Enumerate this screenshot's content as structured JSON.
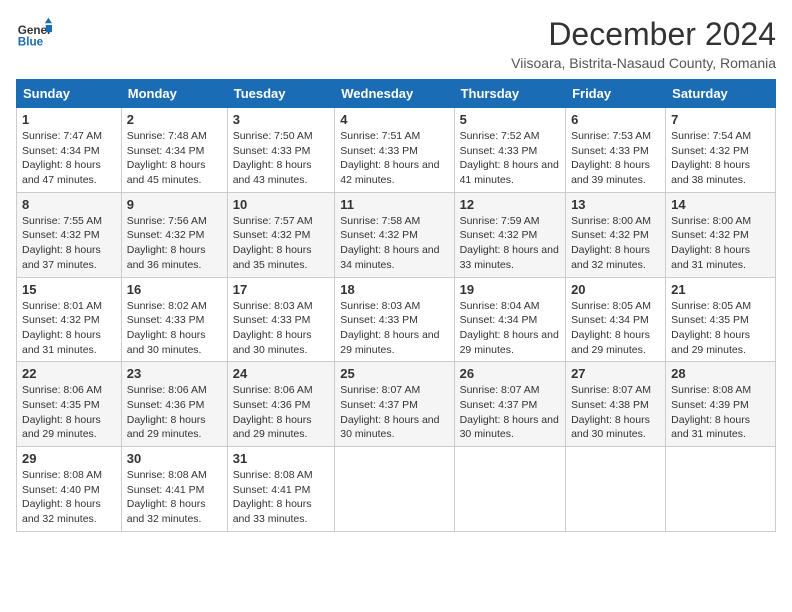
{
  "logo": {
    "general": "General",
    "blue": "Blue"
  },
  "title": "December 2024",
  "location": "Viisoara, Bistrita-Nasaud County, Romania",
  "headers": [
    "Sunday",
    "Monday",
    "Tuesday",
    "Wednesday",
    "Thursday",
    "Friday",
    "Saturday"
  ],
  "weeks": [
    [
      {
        "day": "1",
        "sunrise": "7:47 AM",
        "sunset": "4:34 PM",
        "daylight": "8 hours and 47 minutes."
      },
      {
        "day": "2",
        "sunrise": "7:48 AM",
        "sunset": "4:34 PM",
        "daylight": "8 hours and 45 minutes."
      },
      {
        "day": "3",
        "sunrise": "7:50 AM",
        "sunset": "4:33 PM",
        "daylight": "8 hours and 43 minutes."
      },
      {
        "day": "4",
        "sunrise": "7:51 AM",
        "sunset": "4:33 PM",
        "daylight": "8 hours and 42 minutes."
      },
      {
        "day": "5",
        "sunrise": "7:52 AM",
        "sunset": "4:33 PM",
        "daylight": "8 hours and 41 minutes."
      },
      {
        "day": "6",
        "sunrise": "7:53 AM",
        "sunset": "4:33 PM",
        "daylight": "8 hours and 39 minutes."
      },
      {
        "day": "7",
        "sunrise": "7:54 AM",
        "sunset": "4:32 PM",
        "daylight": "8 hours and 38 minutes."
      }
    ],
    [
      {
        "day": "8",
        "sunrise": "7:55 AM",
        "sunset": "4:32 PM",
        "daylight": "8 hours and 37 minutes."
      },
      {
        "day": "9",
        "sunrise": "7:56 AM",
        "sunset": "4:32 PM",
        "daylight": "8 hours and 36 minutes."
      },
      {
        "day": "10",
        "sunrise": "7:57 AM",
        "sunset": "4:32 PM",
        "daylight": "8 hours and 35 minutes."
      },
      {
        "day": "11",
        "sunrise": "7:58 AM",
        "sunset": "4:32 PM",
        "daylight": "8 hours and 34 minutes."
      },
      {
        "day": "12",
        "sunrise": "7:59 AM",
        "sunset": "4:32 PM",
        "daylight": "8 hours and 33 minutes."
      },
      {
        "day": "13",
        "sunrise": "8:00 AM",
        "sunset": "4:32 PM",
        "daylight": "8 hours and 32 minutes."
      },
      {
        "day": "14",
        "sunrise": "8:00 AM",
        "sunset": "4:32 PM",
        "daylight": "8 hours and 31 minutes."
      }
    ],
    [
      {
        "day": "15",
        "sunrise": "8:01 AM",
        "sunset": "4:32 PM",
        "daylight": "8 hours and 31 minutes."
      },
      {
        "day": "16",
        "sunrise": "8:02 AM",
        "sunset": "4:33 PM",
        "daylight": "8 hours and 30 minutes."
      },
      {
        "day": "17",
        "sunrise": "8:03 AM",
        "sunset": "4:33 PM",
        "daylight": "8 hours and 30 minutes."
      },
      {
        "day": "18",
        "sunrise": "8:03 AM",
        "sunset": "4:33 PM",
        "daylight": "8 hours and 29 minutes."
      },
      {
        "day": "19",
        "sunrise": "8:04 AM",
        "sunset": "4:34 PM",
        "daylight": "8 hours and 29 minutes."
      },
      {
        "day": "20",
        "sunrise": "8:05 AM",
        "sunset": "4:34 PM",
        "daylight": "8 hours and 29 minutes."
      },
      {
        "day": "21",
        "sunrise": "8:05 AM",
        "sunset": "4:35 PM",
        "daylight": "8 hours and 29 minutes."
      }
    ],
    [
      {
        "day": "22",
        "sunrise": "8:06 AM",
        "sunset": "4:35 PM",
        "daylight": "8 hours and 29 minutes."
      },
      {
        "day": "23",
        "sunrise": "8:06 AM",
        "sunset": "4:36 PM",
        "daylight": "8 hours and 29 minutes."
      },
      {
        "day": "24",
        "sunrise": "8:06 AM",
        "sunset": "4:36 PM",
        "daylight": "8 hours and 29 minutes."
      },
      {
        "day": "25",
        "sunrise": "8:07 AM",
        "sunset": "4:37 PM",
        "daylight": "8 hours and 30 minutes."
      },
      {
        "day": "26",
        "sunrise": "8:07 AM",
        "sunset": "4:37 PM",
        "daylight": "8 hours and 30 minutes."
      },
      {
        "day": "27",
        "sunrise": "8:07 AM",
        "sunset": "4:38 PM",
        "daylight": "8 hours and 30 minutes."
      },
      {
        "day": "28",
        "sunrise": "8:08 AM",
        "sunset": "4:39 PM",
        "daylight": "8 hours and 31 minutes."
      }
    ],
    [
      {
        "day": "29",
        "sunrise": "8:08 AM",
        "sunset": "4:40 PM",
        "daylight": "8 hours and 32 minutes."
      },
      {
        "day": "30",
        "sunrise": "8:08 AM",
        "sunset": "4:41 PM",
        "daylight": "8 hours and 32 minutes."
      },
      {
        "day": "31",
        "sunrise": "8:08 AM",
        "sunset": "4:41 PM",
        "daylight": "8 hours and 33 minutes."
      },
      null,
      null,
      null,
      null
    ]
  ]
}
